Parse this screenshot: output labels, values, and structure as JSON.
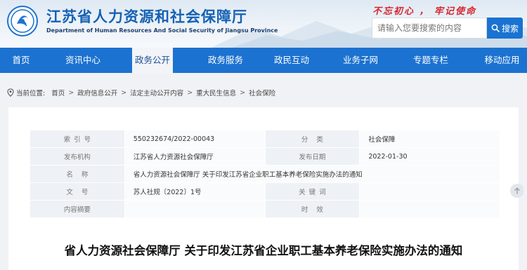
{
  "header": {
    "title_cn": "江苏省人力资源和社会保障厅",
    "title_en": "Department of Human Resources And Social Security of Jiangsu Province",
    "slogan": "不忘初心 ， 牢记使命",
    "logo_icon": "jiangsu-hrss-logo-icon",
    "accent": "#1562b5"
  },
  "search": {
    "placeholder": "请输入您要搜索的内容",
    "button_label": "搜索"
  },
  "nav": {
    "items": [
      {
        "label": "首页"
      },
      {
        "label": "资讯中心"
      },
      {
        "label": "政务公开",
        "active": true
      },
      {
        "label": "政务服务"
      },
      {
        "label": "政民互动"
      },
      {
        "label": "业务子网"
      },
      {
        "label": "专题专栏"
      },
      {
        "label": "移动应用"
      }
    ],
    "background": "#1c72d0"
  },
  "breadcrumb": {
    "prefix": "当前位置:",
    "items": [
      "首页",
      "政府信息公开",
      "法定主动公开内容",
      "重大民生信息",
      "社会保险"
    ]
  },
  "info": {
    "index_label": "索引号",
    "index_value": "550232674/2022-00043",
    "category_label": "分类",
    "category_value": "社会保障",
    "publisher_label": "发布机构",
    "publisher_value": "江苏省人力资源社会保障厅",
    "date_label": "发布日期",
    "date_value": "2022-01-30",
    "name_label": "名称",
    "name_value": "省人力资源社会保障厅 关于印发江苏省企业职工基本养老保险实施办法的通知",
    "docno_label": "文号",
    "docno_value": "苏人社规〔2022〕1号",
    "keywords_label": "关键词",
    "keywords_value": "",
    "summary_label": "内容摘要",
    "summary_value": "",
    "validity_label": "时效",
    "validity_value": ""
  },
  "document": {
    "title": "省人力资源社会保障厅 关于印发江苏省企业职工基本养老保险实施办法的通知"
  }
}
